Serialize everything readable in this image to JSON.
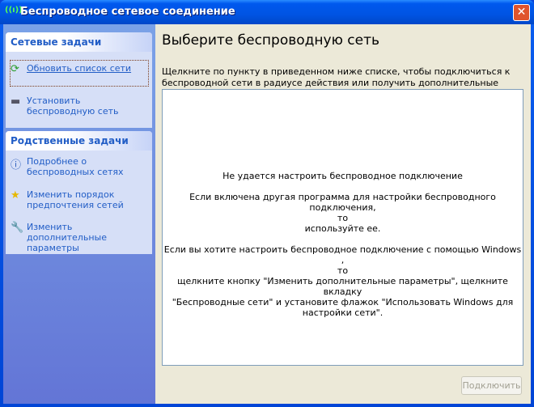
{
  "window": {
    "title": "Беспроводное сетевое соединение",
    "close": "✕"
  },
  "network_tasks": {
    "header": "Сетевые задачи",
    "items": [
      {
        "label": "Обновить список сети",
        "icon": "refresh-icon"
      },
      {
        "label": "Установить беспроводную сеть",
        "icon": "wireless-setup-icon"
      }
    ]
  },
  "related_tasks": {
    "header": "Родственные задачи",
    "items": [
      {
        "label": "Подробнее о беспроводных сетях",
        "icon": "info-icon"
      },
      {
        "label": "Изменить порядок предпочтения  сетей",
        "icon": "star-icon"
      },
      {
        "label": "Изменить дополнительные параметры",
        "icon": "settings-icon"
      }
    ]
  },
  "main": {
    "title": "Выберите беспроводную сеть",
    "description": "Щелкните по пункту в приведенном ниже списке, чтобы подключиться к беспроводной сети в радиусе действия или получить дополнительные сведения.",
    "message": {
      "line1": "Не удается настроить беспроводное подключение",
      "line2": "Если включена другая программа для настройки беспроводного подключения,",
      "line3": "то",
      "line4": "используйте ее.",
      "line5": "Если вы хотите настроить беспроводное подключение с помощью Windows ,",
      "line6": "то",
      "line7": "щелкните кнопку \"Изменить дополнительные параметры\", щелкните вкладку",
      "line8": "\"Беспроводные сети\" и установите флажок \"Использовать Windows для",
      "line9": "настройки сети\"."
    },
    "connect_button": "Подключить"
  }
}
